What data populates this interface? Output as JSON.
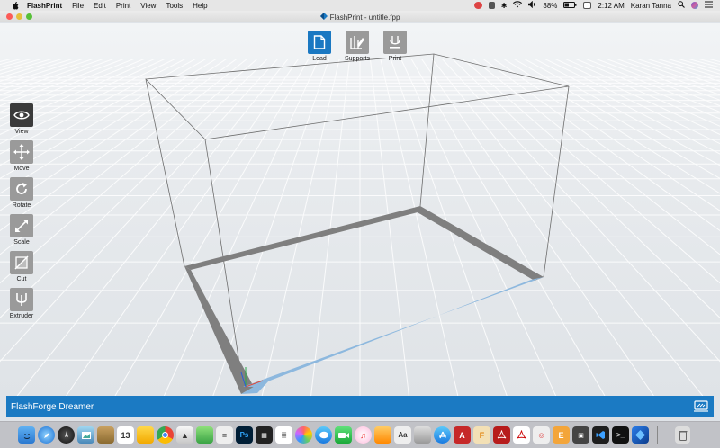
{
  "menubar": {
    "app_name": "FlashPrint",
    "menus": [
      "File",
      "Edit",
      "Print",
      "View",
      "Tools",
      "Help"
    ],
    "battery": "38%",
    "time": "2:12 AM",
    "user": "Karan Tanna"
  },
  "window": {
    "title": "FlashPrint - untitle.fpp"
  },
  "top_toolbar": {
    "load": "Load",
    "supports": "Supports",
    "print": "Print"
  },
  "left_toolbar": {
    "view": "View",
    "move": "Move",
    "rotate": "Rotate",
    "scale": "Scale",
    "cut": "Cut",
    "extruder": "Extruder"
  },
  "statusbar": {
    "printer": "FlashForge Dreamer"
  },
  "dock": {
    "calendar_day": "13"
  },
  "colors": {
    "accent": "#1b7ac3",
    "tool_gray": "#9a9a9a",
    "tool_active_dark": "#3b3b3b",
    "plate_edge": "#7f7f7f",
    "plate_edge_blue": "#8db8de"
  }
}
